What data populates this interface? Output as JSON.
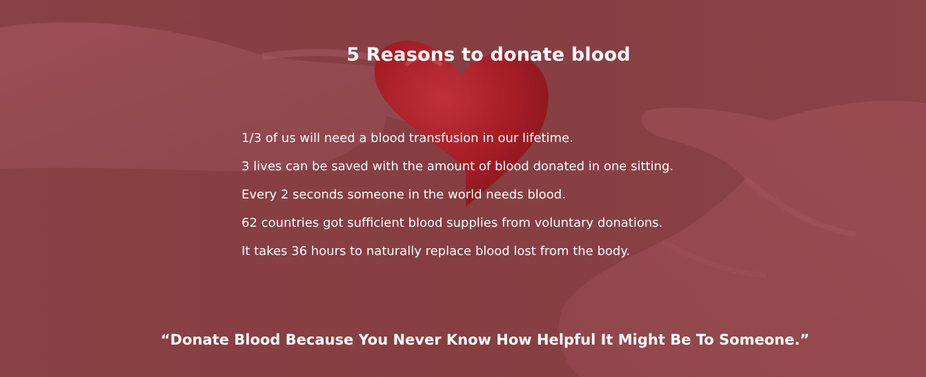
{
  "section": {
    "title": "5 Reasons to donate blood",
    "reasons": [
      "1/3 of us will need a blood transfusion in our lifetime.",
      "3 lives can be saved with the amount of blood donated in one sitting.",
      "Every 2 seconds someone in the world needs blood.",
      "62 countries got sufficient blood supplies from voluntary donations.",
      "It takes 36 hours to naturally replace blood lost from the body."
    ],
    "quote": "“Donate Blood Because You Never Know How Helpful It Might Be To Someone.”"
  },
  "colors": {
    "overlay": "#8a4a4c",
    "heart": "#b8141e",
    "text": "#ffffff"
  },
  "background": {
    "image_subject": "hand-giving-heart-to-open-hand"
  }
}
